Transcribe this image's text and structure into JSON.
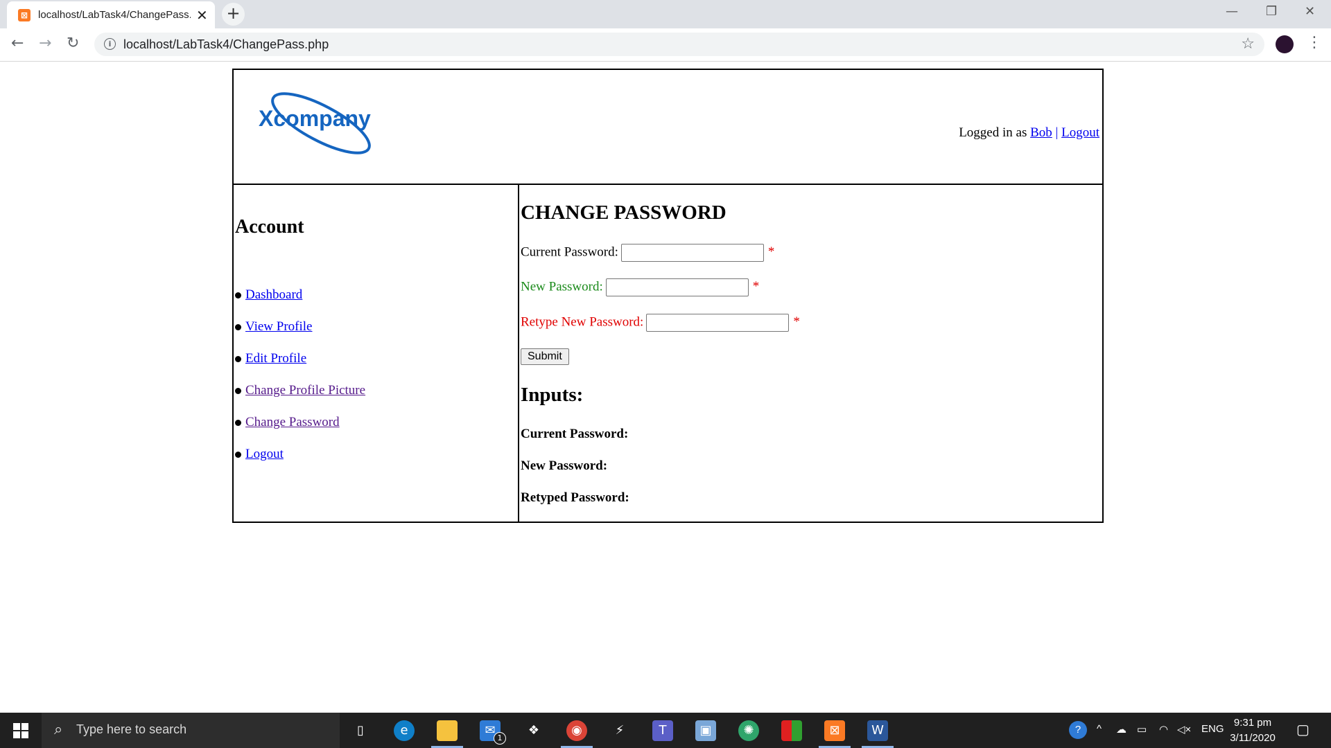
{
  "browser": {
    "tab_title": "localhost/LabTask4/ChangePass.p",
    "url": "localhost/LabTask4/ChangePass.php"
  },
  "header": {
    "logo_text": "Xcompany",
    "logged_in_prefix": "Logged in as",
    "username": "Bob",
    "separator": "|",
    "logout_link": "Logout"
  },
  "sidebar": {
    "title": "Account",
    "items": [
      {
        "label": "Dashboard"
      },
      {
        "label": "View Profile"
      },
      {
        "label": "Edit Profile"
      },
      {
        "label": "Change Profile Picture"
      },
      {
        "label": "Change Password"
      },
      {
        "label": "Logout"
      }
    ]
  },
  "form": {
    "heading": "CHANGE PASSWORD",
    "current_label": "Current Password:",
    "new_label": "New Password:",
    "retype_label": "Retype New Password:",
    "required_mark": "*",
    "submit_label": "Submit",
    "current_value": "",
    "new_value": "",
    "retype_value": ""
  },
  "inputs_section": {
    "heading": "Inputs:",
    "current": "Current Password:",
    "new": "New Password:",
    "retyped": "Retyped Password:"
  },
  "taskbar": {
    "search_placeholder": "Type here to search",
    "language": "ENG",
    "time": "9:31 pm",
    "date": "3/11/2020",
    "mail_badge": "1"
  },
  "colors": {
    "link": "#0000ee",
    "visited_link": "#551a8b",
    "logo_blue": "#1565c0",
    "new_password_label": "#1a8a1a",
    "retype_label": "#e00000",
    "required_star": "#e00000"
  }
}
